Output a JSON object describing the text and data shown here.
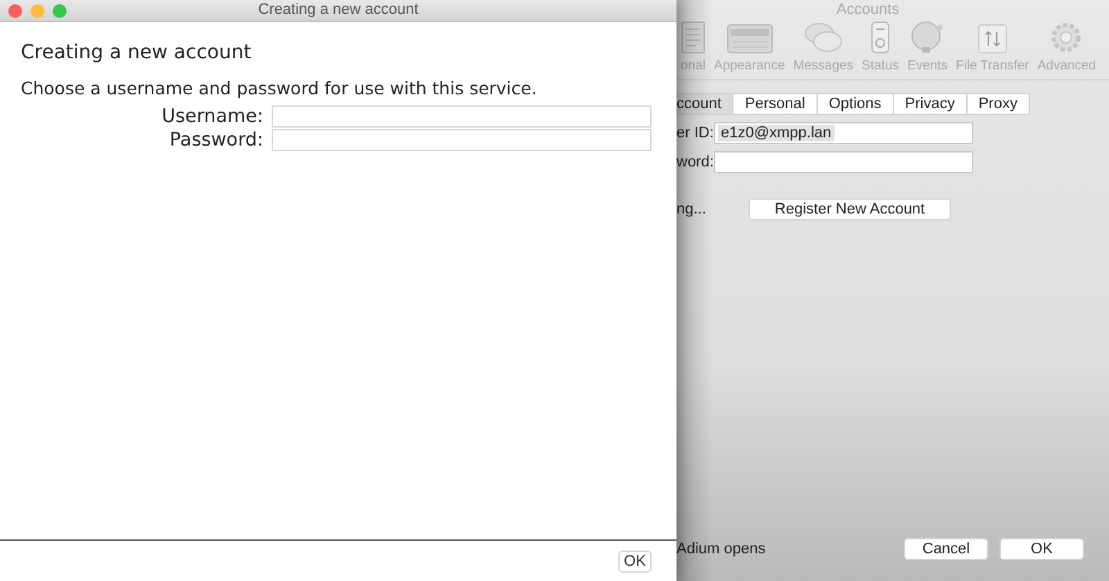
{
  "accounts_window": {
    "title": "Accounts",
    "toolbar": [
      {
        "label": "onal",
        "kind": "personal"
      },
      {
        "label": "Appearance",
        "kind": "appearance"
      },
      {
        "label": "Messages",
        "kind": "messages"
      },
      {
        "label": "Status",
        "kind": "status"
      },
      {
        "label": "Events",
        "kind": "events"
      },
      {
        "label": "File Transfer",
        "kind": "transfer"
      },
      {
        "label": "Advanced",
        "kind": "advanced"
      }
    ],
    "tabs": [
      {
        "label": "ccount",
        "selected": true
      },
      {
        "label": "Personal",
        "selected": false
      },
      {
        "label": "Options",
        "selected": false
      },
      {
        "label": "Privacy",
        "selected": false
      },
      {
        "label": "Proxy",
        "selected": false
      }
    ],
    "fields": [
      {
        "label": "er ID:",
        "value": "e1z0@xmpp.lan"
      },
      {
        "label": "word:"
      }
    ],
    "status_text": "ng...",
    "register_button": "Register New Account",
    "footer_text": "Adium opens",
    "buttons": [
      "Cancel",
      "OK"
    ]
  },
  "dialog": {
    "title": "Creating a new account",
    "heading": "Creating a new account",
    "instructions": "Choose a username and password for use with this service.",
    "fields": [
      {
        "label": "Username:"
      },
      {
        "label": "Password:"
      }
    ],
    "button": "OK"
  }
}
